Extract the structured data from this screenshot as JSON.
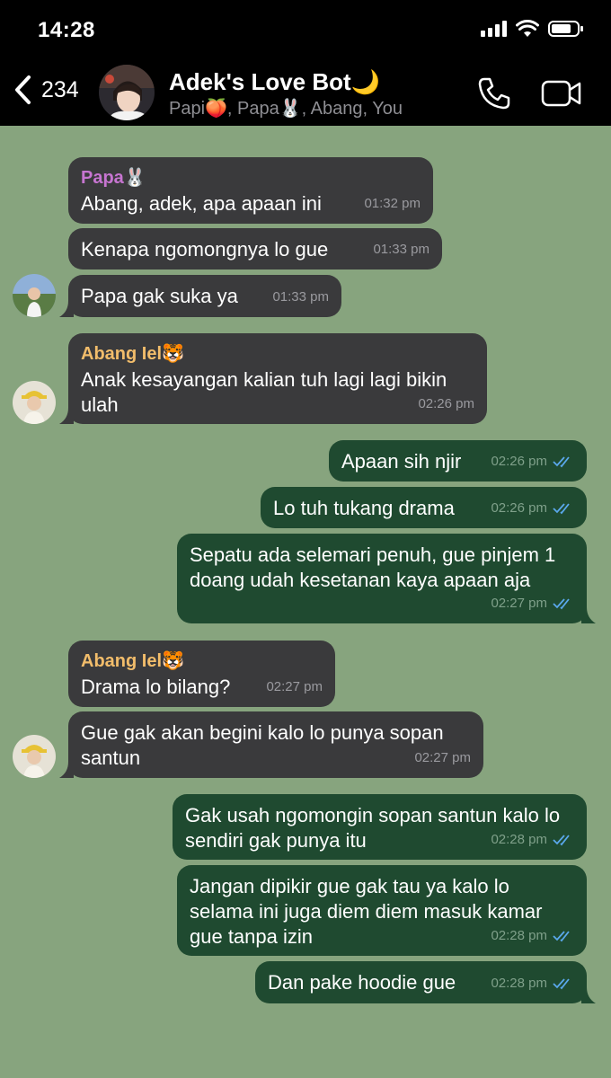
{
  "status_bar": {
    "time": "14:28"
  },
  "header": {
    "back_count": "234",
    "title": "Adek's Love Bot🌙",
    "members": "Papi🍑, Papa🐰, Abang, You"
  },
  "colors": {
    "chat_background": "#87a47e",
    "incoming_bubble": "#3a3a3c",
    "outgoing_bubble": "#1f4a30",
    "papa_name": "#c775d1",
    "abang_name": "#f2bd6b",
    "read_ticks": "#5aa8ec"
  },
  "messages": [
    {
      "sender": "Papa🐰",
      "text": "Abang, adek, apa apaan ini",
      "time": "01:32 pm"
    },
    {
      "text": "Kenapa ngomongnya lo gue",
      "time": "01:33 pm"
    },
    {
      "text": "Papa gak suka ya",
      "time": "01:33 pm"
    },
    {
      "sender": "Abang Iel🐯",
      "text": "Anak kesayangan kalian tuh lagi lagi bikin ulah",
      "time": "02:26 pm"
    },
    {
      "text": "Apaan sih njir",
      "time": "02:26 pm"
    },
    {
      "text": "Lo tuh tukang drama",
      "time": "02:26 pm"
    },
    {
      "text": "Sepatu ada selemari penuh, gue pinjem 1 doang udah kesetanan kaya apaan aja",
      "time": "02:27 pm"
    },
    {
      "sender": "Abang Iel🐯",
      "text": "Drama lo bilang?",
      "time": "02:27 pm"
    },
    {
      "text": "Gue gak akan begini kalo lo punya sopan santun",
      "time": "02:27 pm"
    },
    {
      "text": "Gak usah ngomongin sopan santun kalo lo sendiri gak punya itu",
      "time": "02:28 pm"
    },
    {
      "text": "Jangan dipikir gue gak tau ya kalo lo selama ini juga diem diem masuk kamar gue tanpa izin",
      "time": "02:28 pm"
    },
    {
      "text": "Dan pake hoodie gue",
      "time": "02:28 pm"
    }
  ]
}
